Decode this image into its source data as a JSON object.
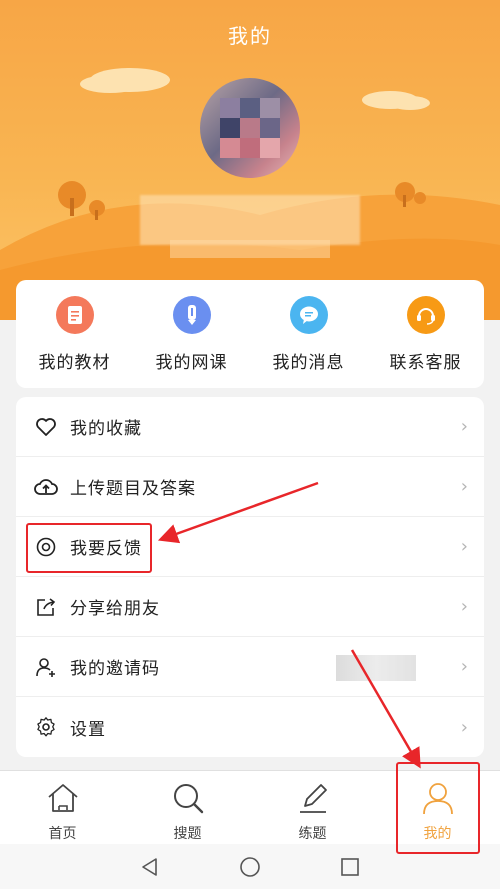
{
  "header": {
    "title": "我的"
  },
  "quick_actions": [
    {
      "label": "我的教材",
      "icon": "textbook-icon",
      "color": "#f4795b"
    },
    {
      "label": "我的网课",
      "icon": "pencil-icon",
      "color": "#6a8ff0"
    },
    {
      "label": "我的消息",
      "icon": "message-icon",
      "color": "#4bb5f0"
    },
    {
      "label": "联系客服",
      "icon": "headset-icon",
      "color": "#f79a15"
    }
  ],
  "menu": [
    {
      "label": "我的收藏",
      "icon": "heart-icon"
    },
    {
      "label": "上传题目及答案",
      "icon": "cloud-upload-icon"
    },
    {
      "label": "我要反馈",
      "icon": "feedback-icon"
    },
    {
      "label": "分享给朋友",
      "icon": "share-icon"
    },
    {
      "label": "我的邀请码",
      "icon": "add-user-icon"
    },
    {
      "label": "设置",
      "icon": "gear-icon"
    }
  ],
  "tabs": [
    {
      "label": "首页",
      "icon": "home-icon"
    },
    {
      "label": "搜题",
      "icon": "search-icon"
    },
    {
      "label": "练题",
      "icon": "edit-icon"
    },
    {
      "label": "我的",
      "icon": "person-icon",
      "active": true
    }
  ],
  "colors": {
    "accent": "#f0a23e",
    "highlight": "#e8262a",
    "header": "#f7a646"
  }
}
